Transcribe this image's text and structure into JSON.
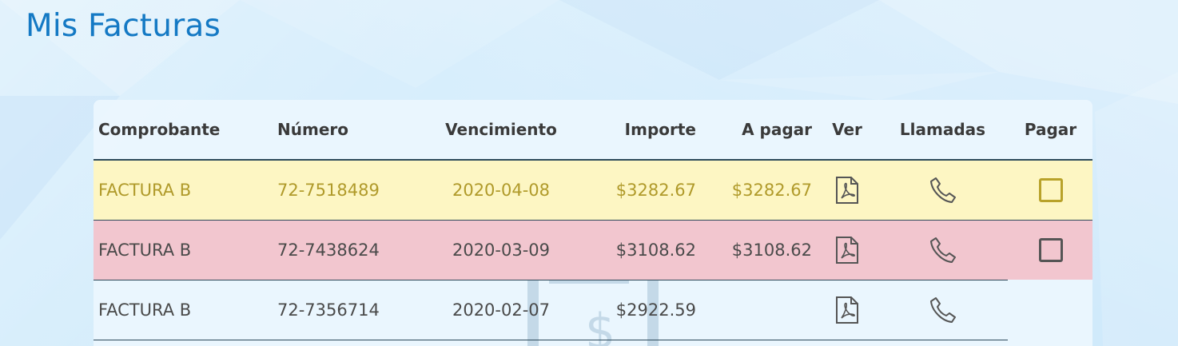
{
  "page": {
    "title": "Mis Facturas"
  },
  "table": {
    "headers": {
      "comprobante": "Comprobante",
      "numero": "Número",
      "vencimiento": "Vencimiento",
      "importe": "Importe",
      "a_pagar": "A pagar",
      "ver": "Ver",
      "llamadas": "Llamadas",
      "pagar": "Pagar"
    },
    "rows": [
      {
        "comprobante": "FACTURA B",
        "numero": "72-7518489",
        "vencimiento": "2020-04-08",
        "importe": "$3282.67",
        "a_pagar": "$3282.67",
        "status_color": "#fdf6c3",
        "ver_icon": "pdf-icon",
        "llamadas_icon": "phone-icon",
        "pagar_checkbox": true
      },
      {
        "comprobante": "FACTURA B",
        "numero": "72-7438624",
        "vencimiento": "2020-03-09",
        "importe": "$3108.62",
        "a_pagar": "$3108.62",
        "status_color": "#f2c6cf",
        "ver_icon": "pdf-icon",
        "llamadas_icon": "phone-icon",
        "pagar_checkbox": true
      },
      {
        "comprobante": "FACTURA B",
        "numero": "72-7356714",
        "vencimiento": "2020-02-07",
        "importe": "$2922.59",
        "a_pagar": "",
        "status_color": "transparent",
        "ver_icon": "pdf-icon",
        "llamadas_icon": "phone-icon",
        "pagar_checkbox": false
      }
    ]
  },
  "colors": {
    "title": "#1479c4",
    "pending_row": "#fdf6c3",
    "overdue_row": "#f2c6cf",
    "pending_text": "#b09a2a"
  }
}
